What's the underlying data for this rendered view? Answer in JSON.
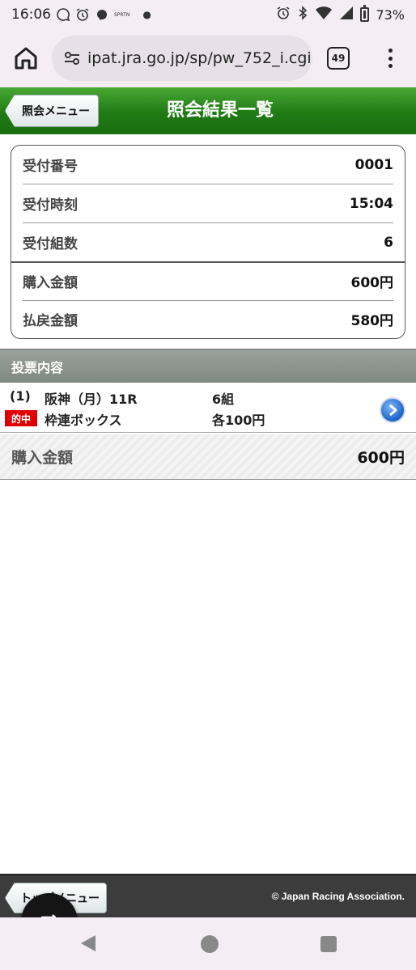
{
  "status_bar": {
    "time": "16:06",
    "small_label": "SPRTN",
    "battery": "73%"
  },
  "browser": {
    "url": "ipat.jra.go.jp/sp/pw_752_i.cgi",
    "tab_count": "49"
  },
  "header": {
    "back_label": "照会メニュー",
    "title": "照会結果一覧"
  },
  "receipt": {
    "rows": [
      {
        "label": "受付番号",
        "value": "0001"
      },
      {
        "label": "受付時刻",
        "value": "15:04"
      },
      {
        "label": "受付組数",
        "value": "6"
      },
      {
        "label": "購入金額",
        "value": "600円"
      },
      {
        "label": "払戻金額",
        "value": "580円"
      }
    ]
  },
  "bets": {
    "section_title": "投票内容",
    "items": [
      {
        "number": "(1)",
        "race": "阪神（月）11R",
        "combos": "6組",
        "hit_badge": "的中",
        "bet_type": "枠連ボックス",
        "unit_amount": "各100円"
      }
    ],
    "total_label": "購入金額",
    "total_value": "600円"
  },
  "footer": {
    "top_menu_label": "トップメニュー",
    "copyright": "© Japan Racing Association."
  },
  "colors": {
    "header_green": "#1f7a14",
    "hit_red": "#e00000",
    "arrow_blue": "#1a62c9"
  }
}
